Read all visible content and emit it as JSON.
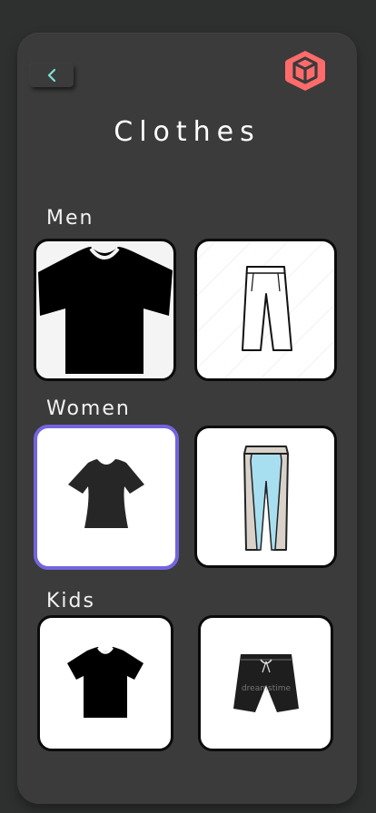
{
  "title": "Clothes",
  "back_icon": "chevron-left-icon",
  "logo_icon": "cube-icon",
  "colors": {
    "background": "#2e302f",
    "card": "#3a3b3a",
    "accent": "#ff6b6b",
    "back_chevron": "#7fe0d6",
    "selected_border": "#7464e0"
  },
  "sections": [
    {
      "label": "Men",
      "items": [
        "tshirt-image",
        "pants-image"
      ]
    },
    {
      "label": "Women",
      "items": [
        "fitted-top-image",
        "leggings-image"
      ],
      "selected_index": 0
    },
    {
      "label": "Kids",
      "items": [
        "kids-tshirt-image",
        "kids-shorts-image"
      ]
    }
  ],
  "watermark": "dreamstime"
}
